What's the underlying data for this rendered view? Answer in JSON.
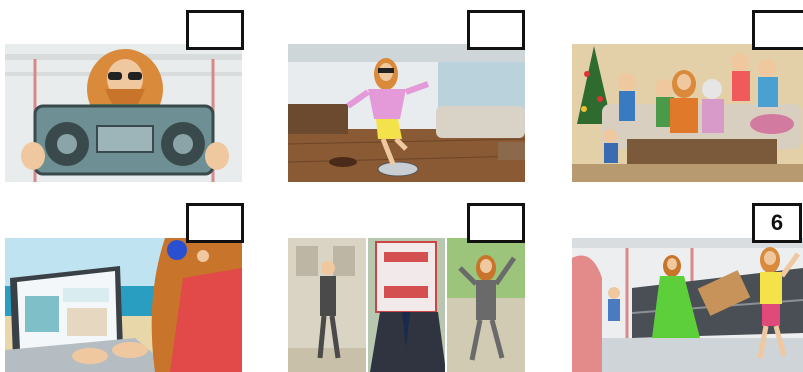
{
  "panels": [
    {
      "id": 1,
      "scene": "man-with-boombox",
      "number": ""
    },
    {
      "id": 2,
      "scene": "man-dancing-on-robot-vacuum",
      "number": ""
    },
    {
      "id": 3,
      "scene": "family-on-sofa-christmas",
      "number": ""
    },
    {
      "id": 4,
      "scene": "man-with-headphones-and-laptop",
      "number": ""
    },
    {
      "id": 5,
      "scene": "man-in-suit-street-triptych",
      "number": ""
    },
    {
      "id": 6,
      "scene": "man-shopping-with-woman",
      "number": "6"
    }
  ],
  "colors": {
    "border": "#111111",
    "beard": "#c8742a",
    "boombox": "#6e8f93",
    "sky": "#bfe3f0"
  }
}
